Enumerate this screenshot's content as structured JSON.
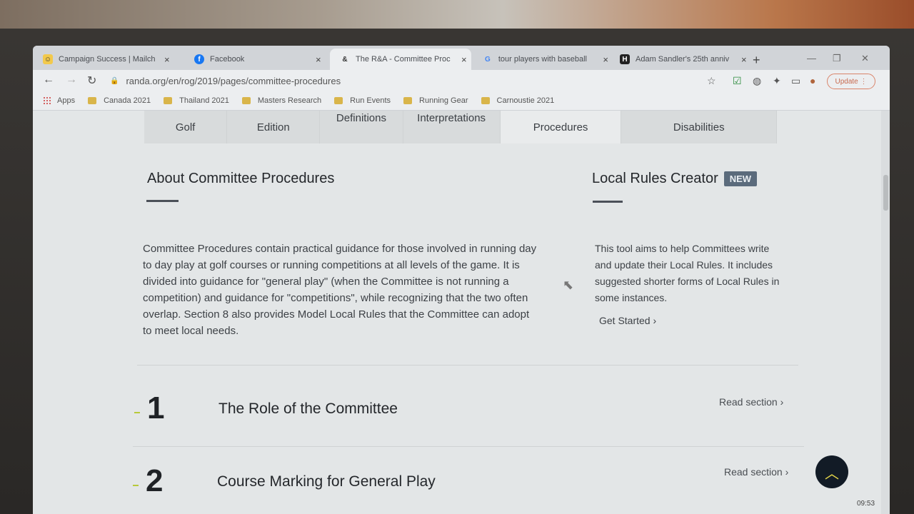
{
  "tabs": [
    {
      "title": "Campaign Success | Mailch",
      "close": "×"
    },
    {
      "title": "Facebook",
      "close": "×"
    },
    {
      "title": "The R&A - Committee Proc",
      "close": "×"
    },
    {
      "title": "tour players with baseball",
      "close": "×"
    },
    {
      "title": "Adam Sandler's 25th anniv",
      "close": "×"
    }
  ],
  "new_tab": "+",
  "address": "randa.org/en/rog/2019/pages/committee-procedures",
  "update_label": "Update",
  "bookmarks": [
    "Apps",
    "Canada 2021",
    "Thailand 2021",
    "Masters Research",
    "Run Events",
    "Running Gear",
    "Carnoustie 2021"
  ],
  "subnav": [
    "Golf",
    "Edition",
    "Definitions",
    "Interpretations",
    "Procedures",
    "Disabilities"
  ],
  "about": {
    "title": "About Committee Procedures",
    "body": "Committee Procedures contain practical guidance for those involved in running day to day play at golf courses or running competitions at all levels of the game. It is divided into guidance for \"general play\" (when the Committee is not running a competition) and guidance for \"competitions\", while recognizing that the two often overlap. Section 8 also provides Model Local Rules that the Committee can adopt to meet local needs."
  },
  "creator": {
    "title": "Local Rules Creator",
    "badge": "NEW",
    "body": "This tool aims to help Committees write and update their Local Rules. It includes suggested shorter forms of Local Rules in some instances.",
    "cta": "Get Started ›"
  },
  "sections": [
    {
      "num": "1",
      "title": "The Role of the Committee",
      "link": "Read section ›"
    },
    {
      "num": "2",
      "title": "Course Marking for General Play",
      "link": "Read section ›"
    }
  ],
  "clock": "09:53"
}
